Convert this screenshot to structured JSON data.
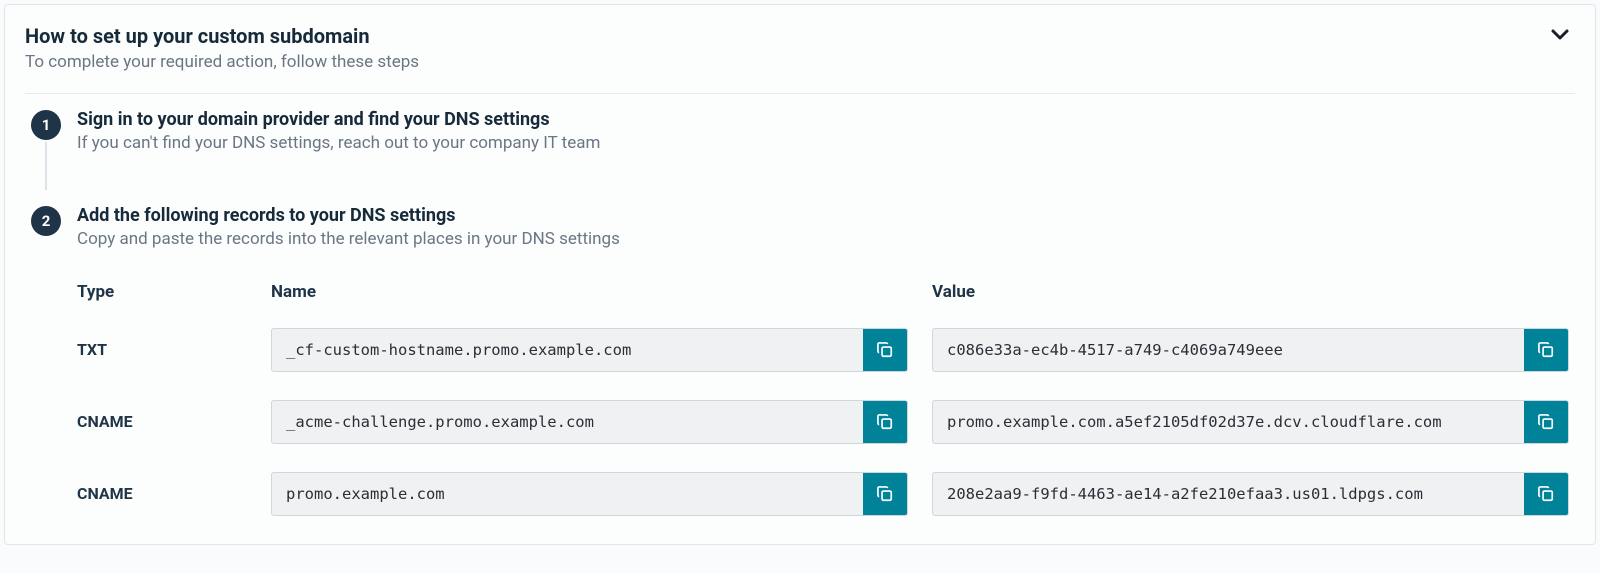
{
  "header": {
    "title": "How to set up your custom subdomain",
    "subtitle": "To complete your required action, follow these steps"
  },
  "steps": {
    "one": {
      "number": "1",
      "title": "Sign in to your domain provider and find your DNS settings",
      "desc": "If you can't find your DNS settings, reach out to your company IT team"
    },
    "two": {
      "number": "2",
      "title": "Add the following records to your DNS settings",
      "desc": "Copy and paste the records into the relevant places in your DNS settings"
    }
  },
  "columns": {
    "type": "Type",
    "name": "Name",
    "value": "Value"
  },
  "records": [
    {
      "type": "TXT",
      "name": "_cf-custom-hostname.promo.example.com",
      "value": "c086e33a-ec4b-4517-a749-c4069a749eee"
    },
    {
      "type": "CNAME",
      "name": "_acme-challenge.promo.example.com",
      "value": "promo.example.com.a5ef2105df02d37e.dcv.cloudflare.com"
    },
    {
      "type": "CNAME",
      "name": "promo.example.com",
      "value": "208e2aa9-f9fd-4463-ae14-a2fe210efaa3.us01.ldpgs.com"
    }
  ],
  "colors": {
    "accent": "#008299",
    "badge": "#1f3446"
  }
}
